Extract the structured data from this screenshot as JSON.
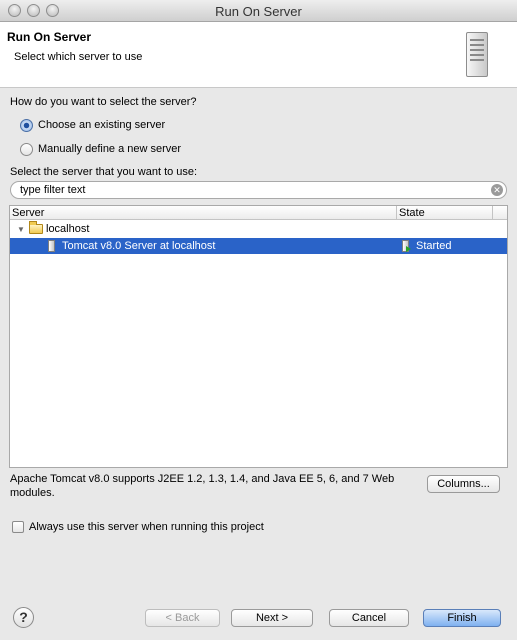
{
  "window": {
    "title": "Run On Server"
  },
  "header": {
    "title": "Run On Server",
    "subtitle": "Select which server to use",
    "icon": "server-icon"
  },
  "selection": {
    "question": "How do you want to select the server?",
    "options": [
      {
        "label": "Choose an existing server",
        "selected": true
      },
      {
        "label": "Manually define a new server",
        "selected": false
      }
    ]
  },
  "filter": {
    "label": "Select the server that you want to use:",
    "value": "type filter text"
  },
  "table": {
    "columns": [
      "Server",
      "State"
    ],
    "host": "localhost",
    "rows": [
      {
        "server": "Tomcat v8.0 Server at localhost",
        "state": "Started",
        "selected": true
      }
    ]
  },
  "description": "Apache Tomcat v8.0 supports J2EE 1.2, 1.3, 1.4, and Java EE 5, 6, and 7 Web modules.",
  "columns_button": "Columns...",
  "always_use": {
    "label": "Always use this server when running this project",
    "checked": false
  },
  "buttons": {
    "help": "?",
    "back": "< Back",
    "next": "Next >",
    "cancel": "Cancel",
    "finish": "Finish"
  },
  "colors": {
    "selection": "#2a63c8",
    "header_bg": "#ffffff",
    "dialog_bg": "#e8e8e8"
  }
}
